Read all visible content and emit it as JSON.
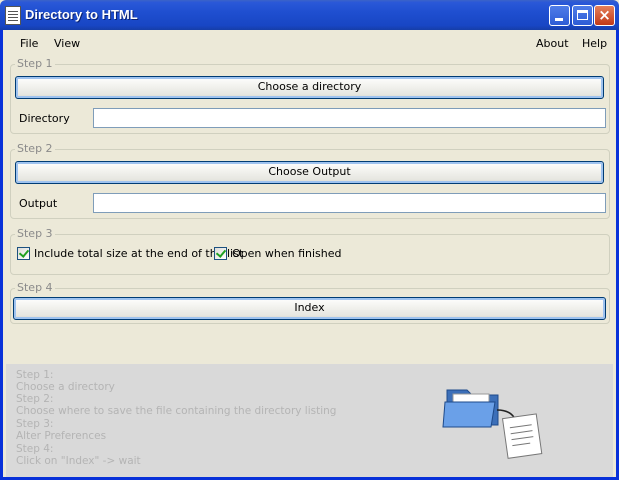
{
  "window": {
    "title": "Directory to HTML"
  },
  "menu": {
    "left": [
      "File",
      "View"
    ],
    "right": [
      "About",
      "Help"
    ]
  },
  "step1": {
    "group_label": "Step 1",
    "button_label": "Choose a directory",
    "field_label": "Directory",
    "field_value": ""
  },
  "step2": {
    "group_label": "Step 2",
    "button_label": "Choose Output",
    "field_label": "Output",
    "field_value": ""
  },
  "step3": {
    "group_label": "Step 3",
    "options": [
      {
        "label": "Include total size at the end of the list",
        "checked": true
      },
      {
        "label": "Open when finished",
        "checked": true
      }
    ]
  },
  "step4": {
    "group_label": "Step 4",
    "button_label": "Index"
  },
  "instructions": [
    "Step 1:",
    "Choose a directory",
    "Step 2:",
    "Choose where to save the file containing the directory listing",
    "Step 3:",
    "Alter Preferences",
    "Step 4:",
    "Click on \"Index\" -> wait"
  ],
  "icons": {
    "app": "document-icon",
    "illustration": "folder-to-document-icon"
  }
}
